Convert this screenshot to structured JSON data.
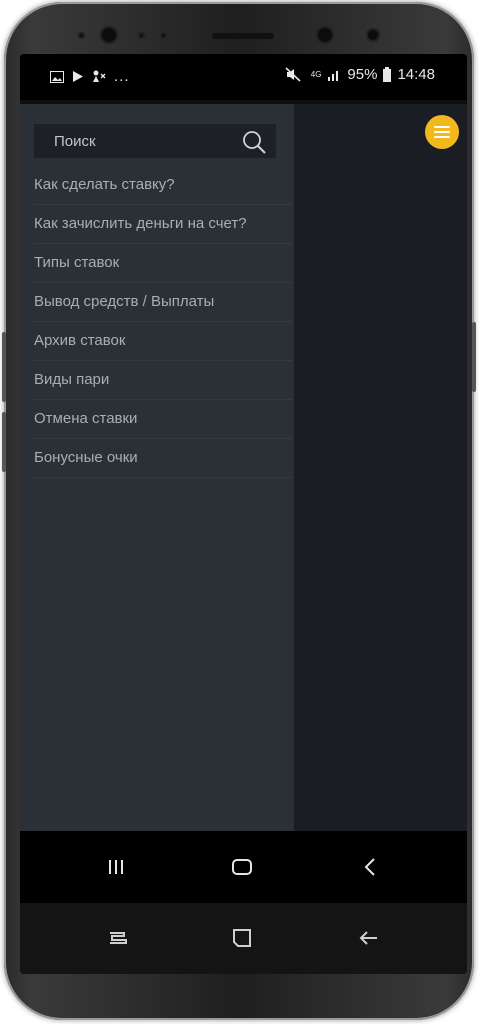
{
  "status_bar": {
    "battery": "95%",
    "time": "14:48",
    "network": "4G",
    "left_icons": [
      "image-icon",
      "play-store-icon",
      "cast-icon"
    ],
    "more": "..."
  },
  "search": {
    "placeholder": "Поиск"
  },
  "menu": {
    "items": [
      {
        "label": "Как сделать ставку?"
      },
      {
        "label": "Как зачислить деньги на счет?"
      },
      {
        "label": "Типы ставок"
      },
      {
        "label": "Вывод средств / Выплаты"
      },
      {
        "label": "Архив ставок"
      },
      {
        "label": "Виды пари"
      },
      {
        "label": "Отмена ставки"
      },
      {
        "label": "Бонусные очки"
      }
    ]
  },
  "colors": {
    "drawer_bg": "#2b3036",
    "content_bg": "#1a1d24",
    "accent": "#f3b81b",
    "menu_text": "#a9aeb4"
  }
}
